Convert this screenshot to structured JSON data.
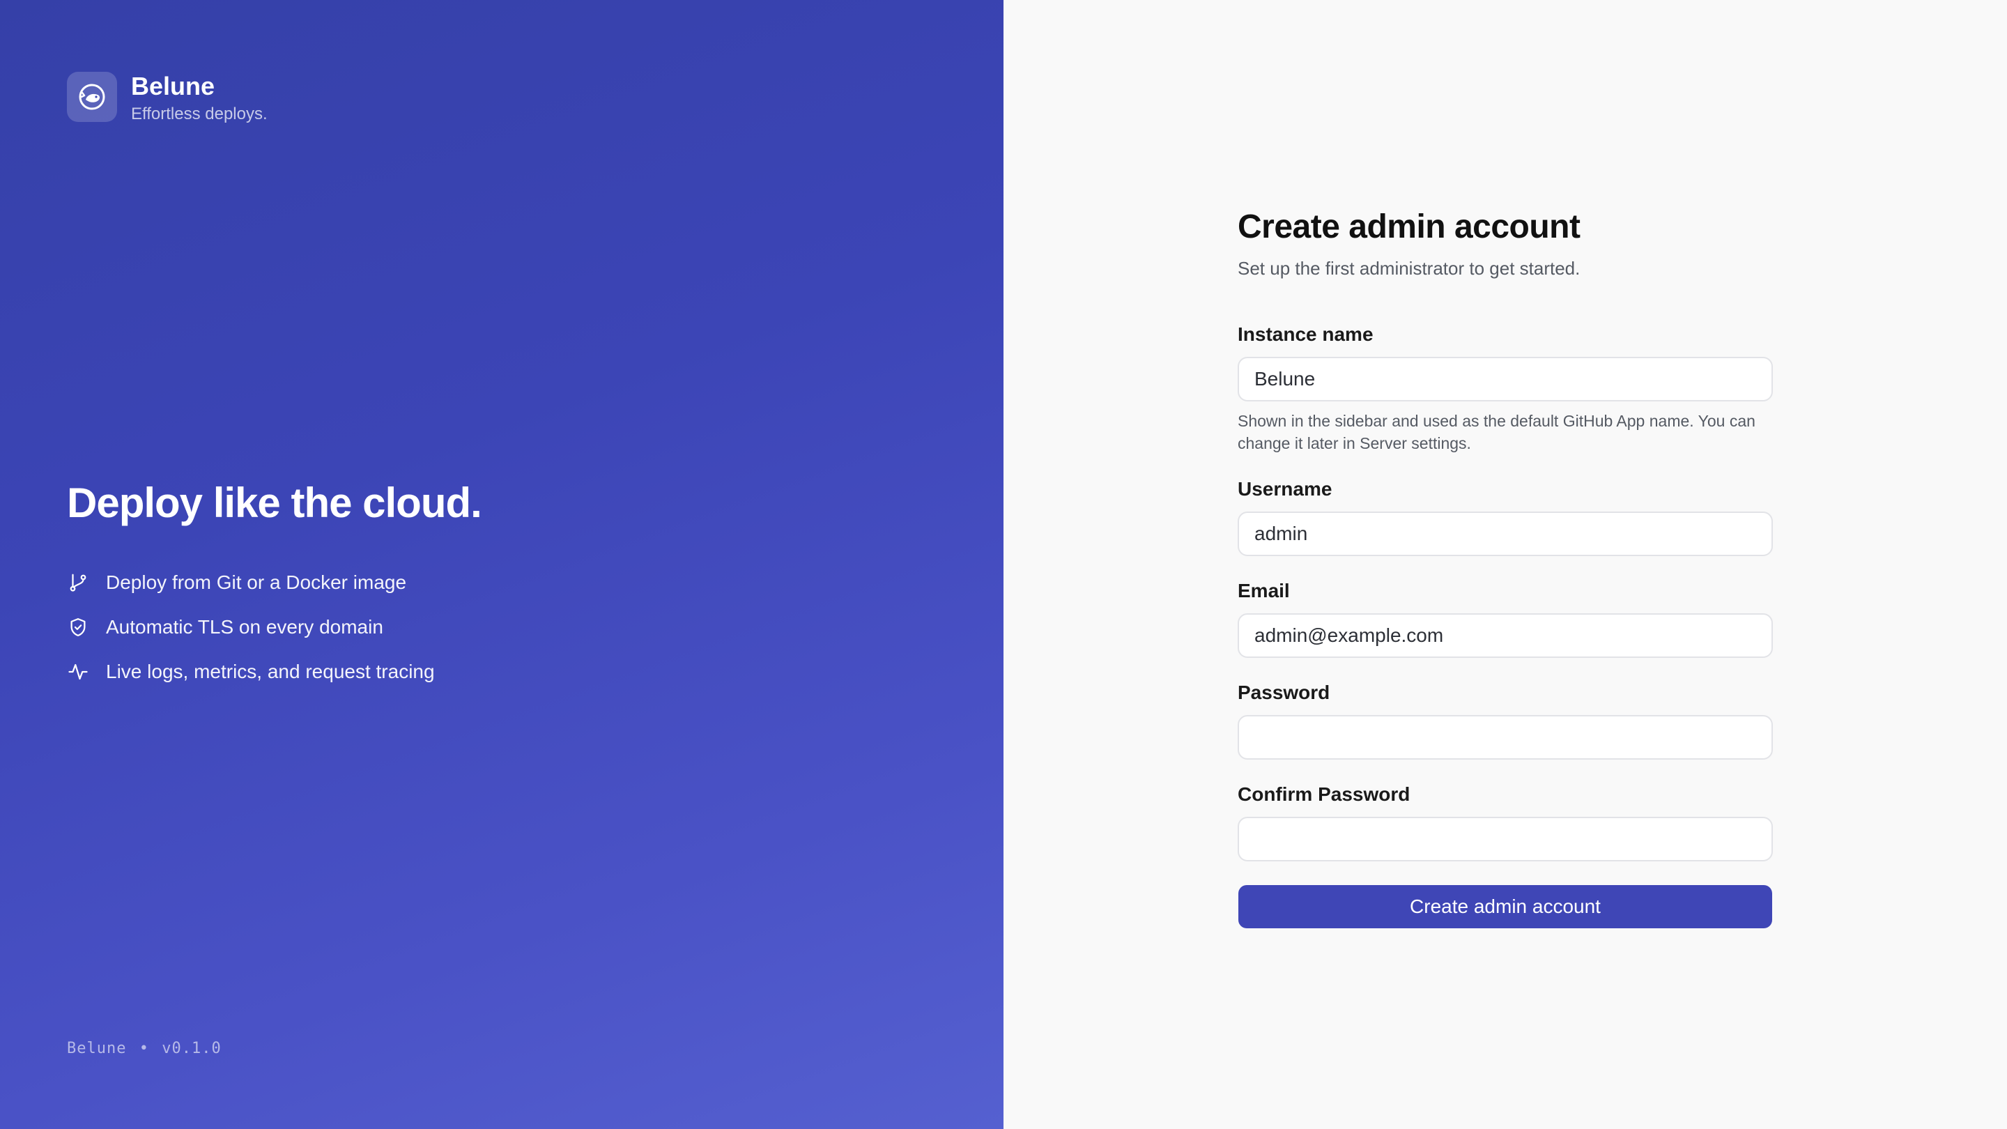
{
  "brand": {
    "name": "Belune",
    "tagline": "Effortless deploys."
  },
  "hero": {
    "title": "Deploy like the cloud.",
    "features": [
      {
        "icon": "git-branch-icon",
        "label": "Deploy from Git or a Docker image"
      },
      {
        "icon": "shield-check-icon",
        "label": "Automatic TLS on every domain"
      },
      {
        "icon": "activity-icon",
        "label": "Live logs, metrics, and request tracing"
      }
    ]
  },
  "footer": {
    "app": "Belune",
    "separator": "•",
    "version": "v0.1.0"
  },
  "form": {
    "title": "Create admin account",
    "subtitle": "Set up the first administrator to get started.",
    "instance_name": {
      "label": "Instance name",
      "value": "Belune",
      "help": "Shown in the sidebar and used as the default GitHub App name. You can change it later in Server settings."
    },
    "username": {
      "label": "Username",
      "value": "admin"
    },
    "email": {
      "label": "Email",
      "value": "admin@example.com"
    },
    "password": {
      "label": "Password",
      "value": ""
    },
    "confirm_password": {
      "label": "Confirm Password",
      "value": ""
    },
    "submit_label": "Create admin account"
  },
  "colors": {
    "accent": "#3f46b6",
    "panel_gradient_start": "#3540a8",
    "panel_gradient_end": "#5560d0",
    "page_bg": "#f9f9f9"
  }
}
